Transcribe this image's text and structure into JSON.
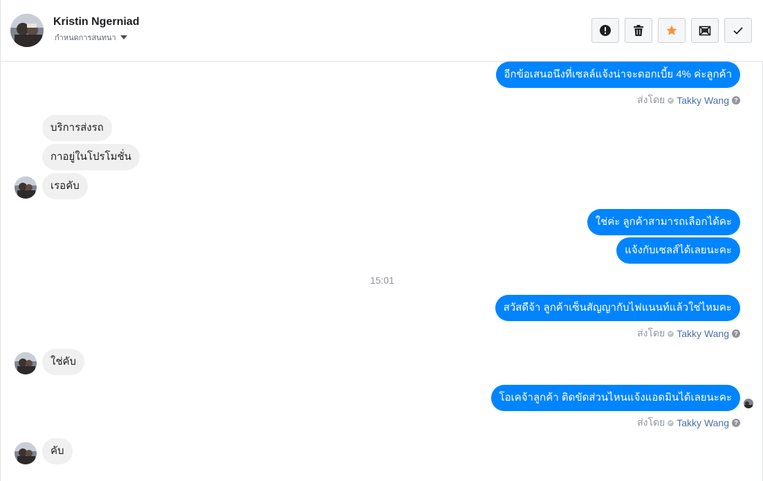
{
  "header": {
    "contact_name": "Kristin Ngerniad",
    "assign_label": "กำหนดการสนทนา",
    "actions": [
      {
        "name": "report-spam-button",
        "icon": "exclamation-icon"
      },
      {
        "name": "delete-button",
        "icon": "trash-icon"
      },
      {
        "name": "star-button",
        "icon": "star-icon"
      },
      {
        "name": "mark-unread-button",
        "icon": "envelope-icon"
      },
      {
        "name": "mark-done-button",
        "icon": "check-icon"
      }
    ]
  },
  "colors": {
    "outgoing_bubble": "#0084ff",
    "incoming_bubble": "#f1f0f0",
    "star": "#f7923b"
  },
  "messages": {
    "m1": "อีกข้อเสนอนึงที่เซลล์แจ้งน่าจะดอกเบี้ย 4% ค่ะลูกค้า",
    "m2": "บริการส่งรถ",
    "m3": "กาอยู่ในโปรโมชั่น",
    "m4": "เรอคับ",
    "m5": "ใช่ค่ะ ลูกค้าสามารถเลือกได้คะ",
    "m6": "แจ้งกับเซลส์ได้เลยนะคะ",
    "time": "15:01",
    "m7": "สวัสดีจ้า ลูกค้าเซ็นสัญญากับไฟแนนท์แล้วใช่ไหมคะ",
    "m8": "ใช่คับ",
    "m9": "โอเคจ้าลูกค้า ติดขัดส่วนไหนแจ้งแอดมินได้เลยนะคะ",
    "m10": "คับ"
  },
  "sent_by": {
    "label": "ส่งโดย",
    "agent": "Takky Wang",
    "help": "?"
  }
}
